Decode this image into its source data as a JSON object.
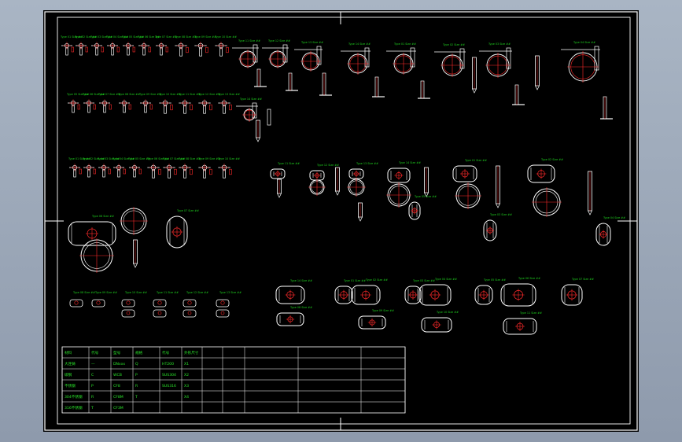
{
  "colors": {
    "outline": "#ffffff",
    "centerline": "#ff2a2a",
    "label": "#1fd21f",
    "frame": "#ffffff"
  },
  "drawing": {
    "part_labels": [
      "Type 01 Size ##",
      "Type 02 Size ##",
      "Type 03 Size ##",
      "Type 04 Size ##",
      "Type 05 Size ##",
      "Type 06 Size ##",
      "Type 07 Size ##",
      "Type 08 Size ##",
      "Type 09 Size ##",
      "Type 10 Size ##",
      "Type 11 Size ##",
      "Type 12 Size ##",
      "Type 13 Size ##",
      "Type 14 Size ##"
    ]
  },
  "title_block": {
    "rows": [
      [
        "材料",
        "代号",
        "型号",
        "规格",
        "代号",
        "外形尺寸",
        "",
        "",
        ""
      ],
      [
        "大连铸",
        "—",
        "DNxxx",
        "Q",
        "HT200",
        "X1",
        "",
        "",
        ""
      ],
      [
        "碳钢",
        "C",
        "WCB",
        "P",
        "SUS304",
        "X2",
        "",
        "",
        ""
      ],
      [
        "不锈钢",
        "P",
        "CF8",
        "R",
        "SUS316",
        "X3",
        "",
        "",
        ""
      ],
      [
        "304不锈钢",
        "R",
        "CF8M",
        "T",
        "",
        "X4",
        "",
        "",
        ""
      ],
      [
        "316不锈钢",
        "T",
        "CF3M",
        "",
        "",
        "",
        "",
        "",
        ""
      ]
    ]
  }
}
